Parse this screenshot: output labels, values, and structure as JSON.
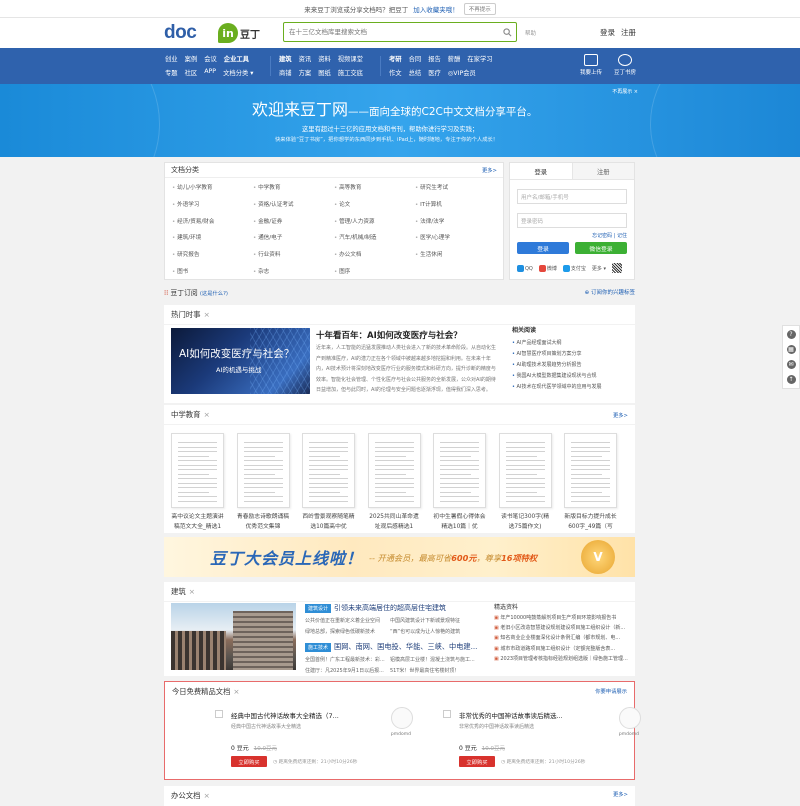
{
  "topnotice": {
    "text": "来来豆丁浏览或分享文档吗？把豆丁",
    "fav": "加入收藏夹哦！",
    "nomore": "不再提示"
  },
  "header": {
    "search_placeholder": "在十三亿文档库里搜索文档",
    "help": "帮助",
    "upload": "登录",
    "register": "注册"
  },
  "nav": {
    "group1": {
      "row1": [
        "创业",
        "案例",
        "会议",
        "企业工具"
      ],
      "row2": [
        "专题",
        "社区",
        "APP",
        "文档分类 ▾"
      ]
    },
    "group2": {
      "row1": [
        "建筑",
        "资讯",
        "资料",
        "视频课堂"
      ],
      "row2": [
        "商铺",
        "方案",
        "图纸",
        "施工交底"
      ]
    },
    "group3": {
      "row1": [
        "考研",
        "合同",
        "报告",
        "薪酬",
        "在家学习"
      ],
      "row2": [
        "作文",
        "总结",
        "医疗",
        "◎VIP会员"
      ]
    },
    "right": [
      "我要上传",
      "豆丁书房"
    ]
  },
  "banner": {
    "title": "欢迎来豆丁网",
    "title_tail": "——面向全球的C2C中文文档分享平台。",
    "line1": "这里有超过十三亿的应用文档和书刊，帮助你进行学习及实践；",
    "line2": "快来体验“豆丁书房”，把你想学的东西同步到手机、iPad上，随时随地，专注于你的个人成长！",
    "ad": "不再展示 ×"
  },
  "categories": {
    "title": "文档分类",
    "more": "更多>",
    "items": [
      "幼儿/小学教育",
      "中学教育",
      "高等教育",
      "研究生考试",
      "外语学习",
      "资格/认证考试",
      "论文",
      "IT计算机",
      "经济/贸易/财会",
      "金融/证券",
      "管理/人力资源",
      "法律/法学",
      "建筑/环境",
      "通信/电子",
      "汽车/机械/制造",
      "医学/心理学",
      "研究报告",
      "行业资料",
      "办公文档",
      "生活休闲",
      "图书",
      "杂志",
      "图序",
      ""
    ]
  },
  "login": {
    "tab_login": "登录",
    "tab_register": "注册",
    "user_placeholder": "用户名/邮箱/手机号",
    "pass_placeholder": "登录密码",
    "forgot": "忘记密码 | 记住",
    "btn_login": "登录",
    "btn_wechat": "微信登录",
    "social": [
      "QQ",
      "微博",
      "支付宝",
      "更多 ▾"
    ],
    "colors": {
      "login": "#2e7ad9",
      "wechat": "#3cb034"
    }
  },
  "subbar": {
    "left": "豆丁订阅",
    "left_note": "(这是什么?)",
    "right": "订阅你的兴趣标签"
  },
  "hot": {
    "title": "热门时事",
    "img_title": "AI如何改变医疗与社会？",
    "img_sub": "AI的机遇与挑战",
    "headline": "十年看百年：AI如何改变医疗与社会？",
    "para": "近年来，人工智能的迅猛发展推动人类社会进入了新的技术革命阶段。从自动化生产到精准医疗，AI的潜力正在各个领域中被越来越多地挖掘和利用。在未来十年内，AI技术预计将深刻地改变医疗行业的服务模式和科研方向，提升诊断的精度与效率。智能化社会管理、个性化医疗与社会公共服务的全新发展，公众对AI的期待日益增加，但与此同时，AI的伦理与安全问题也逐渐浮现，值得我们深入思考。",
    "related_title": "相关阅读",
    "related": [
      "AI产品经理面试大纲",
      "AI智慧医疗项目策划方案分享",
      "AI助理技术发展趋势分析报告",
      "我国AI大模型数据集建设现状与合规",
      "AI技术在现代医学领域中的应用与发展"
    ]
  },
  "middle": {
    "title": "中学教育",
    "more": "更多>",
    "docs": [
      "高中议论文主题演讲稿范文大全_精选1",
      "青春励志诗歌朗诵稿优秀范文集锦",
      "西岭雪景观察随笔精选10篇高中优",
      "2025共同山革命遗址观后感精选1",
      "初中生暑假心得体会精选10篇｜优",
      "读书笔记300字(精选75篇作文)",
      "新版目标力提升成长600字_49篇（写"
    ]
  },
  "vip": {
    "big": "豆丁大会员上线啦！",
    "small_pre": "-- 开通会员，最高可省",
    "small_num": "600元",
    "small_mid": "，尊享",
    "small_num2": "16项特权",
    "badge": "V"
  },
  "building": {
    "title": "建筑",
    "tag1": "建筑设计",
    "h1": "引领未来高端居住的超高层住宅建筑",
    "s1a": "公共价值正在重新定义着企业空间",
    "s1b": "中国风建筑设计下新城景观特征",
    "s2a": "绿地总部，探索绿色低碳新技术",
    "s2b": "“西”也可以成为让人惊艳的建筑",
    "tag2": "施工技术",
    "h2": "国网、南网、国电投、华能、三峡、中电建...",
    "s3a": "全国首例！广东工程最新技术：彩...",
    "s3b": "铝模高层工业楼！混凝土浇筑与施工...",
    "s4a": "住建厅：凡2025年9月1日以后报...",
    "s4b": "51T米！世界最高住宅楼封顶！",
    "jp_title": "精选资料",
    "jp": [
      "年产10000吨鼓蒸解剂项目生产项目环境影响报告书",
      "老旧小区改造智慧建设规划建设项目施工组织设计（新...",
      "知名商业企业楼面深化设计条例汇编（都市规划、电...",
      "城市市政道路项目施工组织设计（定额完整版含表...",
      "2023项目管理考核指标经验规划组选版｜绿色施工管理..."
    ]
  },
  "free": {
    "title": "今日免费精品文档",
    "more": "你要申请展示",
    "items": [
      {
        "title": "经典中国古代神话故事大全精选（7...",
        "sub": "经典中国古代神话故事大全精选",
        "logo": "pmdomd",
        "price": "0 豆元",
        "orig": "10.0豆元",
        "btn": "立即购买",
        "deadline": "距离免费结束还剩：21小时10分26秒"
      },
      {
        "title": "非常优秀的中国神话故事读后精选...",
        "sub": "非常优秀的中国神话故事读后精选",
        "logo": "pmdomd",
        "price": "0 豆元",
        "orig": "10.0豆元",
        "btn": "立即购买",
        "deadline": "距离免费结束还剩：21小时10分26秒"
      }
    ]
  },
  "office": {
    "title": "办公文档",
    "more": "更多>"
  },
  "colors": {
    "nav": "#2f62ad",
    "banner": "#1a8ad8",
    "accent_green": "#6aae1f",
    "link": "#1e5fb3",
    "free_border": "#e86b6b",
    "buy": "#d8322d"
  },
  "rtools": [
    "?",
    "▦",
    "✉",
    "↑"
  ]
}
